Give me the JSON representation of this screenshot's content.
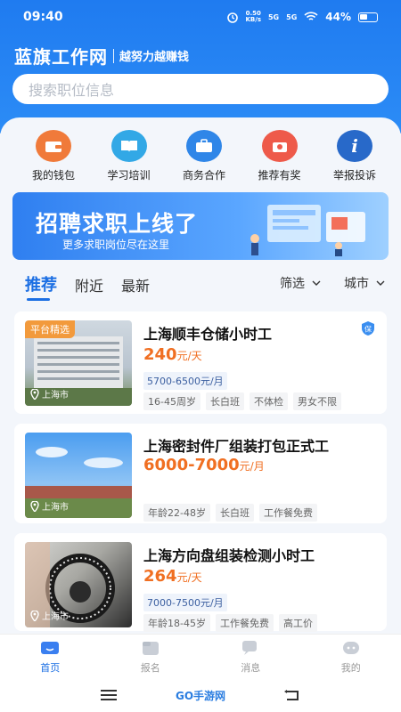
{
  "status": {
    "time": "09:40",
    "net_speed": "0.50\nKB/s",
    "signal1": "5G",
    "signal2": "5G",
    "battery": "44%"
  },
  "app": {
    "title": "蓝旗工作网",
    "slogan": "越努力越赚钱"
  },
  "search": {
    "placeholder": "搜索职位信息"
  },
  "quick": [
    {
      "label": "我的钱包",
      "color": "#f07a3a",
      "icon": "wallet-icon"
    },
    {
      "label": "学习培训",
      "color": "#32a8e6",
      "icon": "book-icon"
    },
    {
      "label": "商务合作",
      "color": "#2f86e8",
      "icon": "briefcase-icon"
    },
    {
      "label": "推荐有奖",
      "color": "#ee5a4a",
      "icon": "gift-icon"
    },
    {
      "label": "举报投诉",
      "color": "#2869c9",
      "icon": "info-icon"
    }
  ],
  "banner": {
    "title": "招聘求职上线了",
    "subtitle": "更多求职岗位尽在这里"
  },
  "tabs": [
    {
      "label": "推荐",
      "active": true
    },
    {
      "label": "附近"
    },
    {
      "label": "最新"
    }
  ],
  "filters": [
    {
      "label": "筛选"
    },
    {
      "label": "城市"
    }
  ],
  "jobs": [
    {
      "badge": "平台精选",
      "title": "上海顺丰仓储小时工",
      "salary": "240",
      "unit": "元/天",
      "range": "5700-6500元/月",
      "tags": [
        "16-45周岁",
        "长白班",
        "不体检",
        "男女不限"
      ],
      "location": "上海市",
      "guarantee": "保"
    },
    {
      "title": "上海密封件厂组装打包正式工",
      "salary": "6000-7000",
      "unit": "元/月",
      "tags": [
        "年龄22-48岁",
        "长白班",
        "工作餐免费"
      ],
      "location": "上海市"
    },
    {
      "title": "上海方向盘组装检测小时工",
      "salary": "264",
      "unit": "元/天",
      "range": "7000-7500元/月",
      "tags": [
        "年龄18-45岁",
        "工作餐免费",
        "高工价"
      ],
      "location": "上海市"
    }
  ],
  "nav": [
    {
      "label": "首页",
      "active": true
    },
    {
      "label": "报名"
    },
    {
      "label": "消息"
    },
    {
      "label": "我的"
    }
  ],
  "watermark": "GO手游网"
}
